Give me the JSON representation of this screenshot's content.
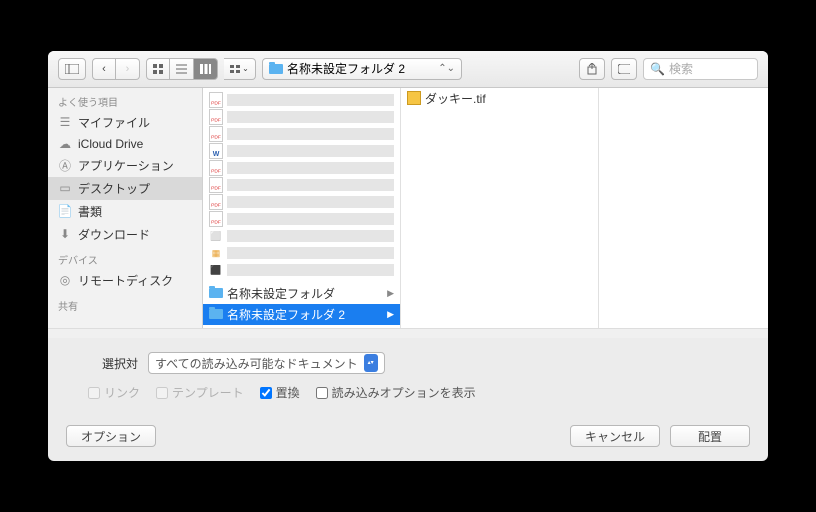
{
  "toolbar": {
    "path_label": "名称未設定フォルダ 2",
    "search_placeholder": "検索"
  },
  "sidebar": {
    "favorites_header": "よく使う項目",
    "items": [
      {
        "label": "マイファイル",
        "icon": "file"
      },
      {
        "label": "iCloud Drive",
        "icon": "cloud"
      },
      {
        "label": "アプリケーション",
        "icon": "app"
      },
      {
        "label": "デスクトップ",
        "icon": "desktop",
        "selected": true
      },
      {
        "label": "書類",
        "icon": "doc"
      },
      {
        "label": "ダウンロード",
        "icon": "download"
      }
    ],
    "devices_header": "デバイス",
    "devices": [
      {
        "label": "リモートディスク",
        "icon": "disc"
      }
    ],
    "shared_header": "共有"
  },
  "col1": {
    "folder1": "名称未設定フォルダ",
    "folder2": "名称未設定フォルダ 2"
  },
  "col2": {
    "file1": "ダッキー.tif"
  },
  "options": {
    "enable_label": "選択対",
    "filter_value": "すべての読み込み可能なドキュメント",
    "link": "リンク",
    "template": "テンプレート",
    "replace": "置換",
    "show_import": "読み込みオプションを表示"
  },
  "footer": {
    "options": "オプション",
    "cancel": "キャンセル",
    "place": "配置"
  }
}
